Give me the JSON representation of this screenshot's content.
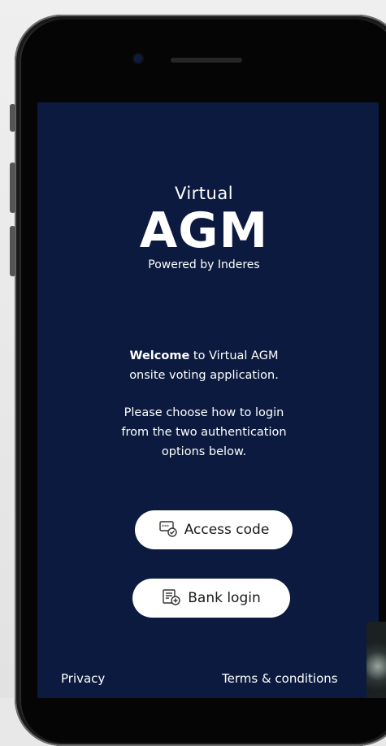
{
  "logo": {
    "line1": "Virtual",
    "line2": "AGM",
    "line3": "Powered by Inderes"
  },
  "welcome": {
    "bold": "Welcome",
    "rest": " to Virtual AGM",
    "line2": "onsite voting application."
  },
  "instructions": {
    "line1": "Please choose how to login",
    "line2": "from the two authentication",
    "line3": "options below."
  },
  "buttons": {
    "access_code": "Access code",
    "bank_login": "Bank login"
  },
  "footer": {
    "privacy": "Privacy",
    "terms": "Terms & conditions"
  },
  "colors": {
    "screen_bg": "#0b1a3e",
    "button_bg": "#ffffff",
    "text": "#ffffff"
  }
}
